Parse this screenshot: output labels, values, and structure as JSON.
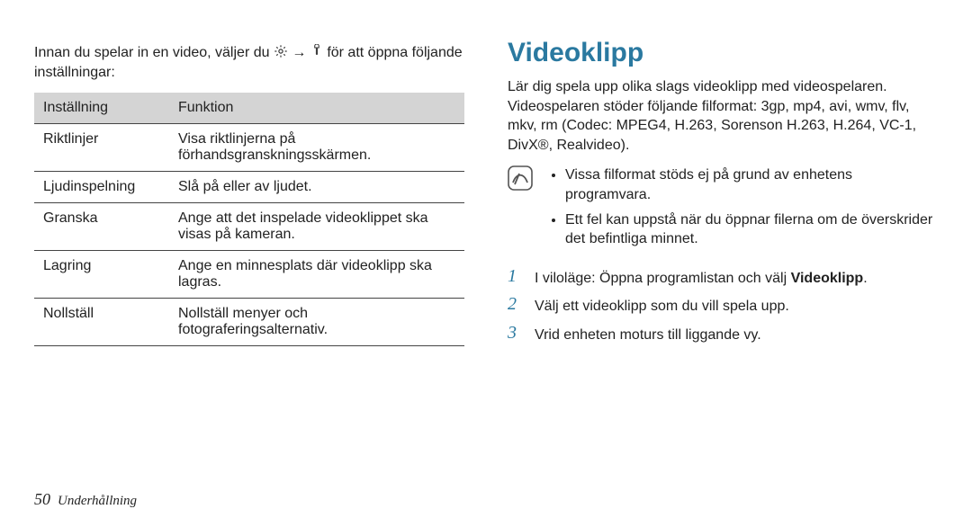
{
  "left": {
    "intro_prefix": "Innan du spelar in en video, väljer du ",
    "intro_arrow": "→",
    "intro_suffix": " för att öppna följande inställningar:",
    "table": {
      "headers": {
        "setting": "Inställning",
        "function": "Funktion"
      },
      "rows": [
        {
          "setting": "Riktlinjer",
          "function": "Visa riktlinjerna på förhandsgranskningsskärmen."
        },
        {
          "setting": "Ljudinspelning",
          "function": "Slå på eller av ljudet."
        },
        {
          "setting": "Granska",
          "function": "Ange att det inspelade videoklippet ska visas på kameran."
        },
        {
          "setting": "Lagring",
          "function": "Ange en minnesplats där videoklipp ska lagras."
        },
        {
          "setting": "Nollställ",
          "function": "Nollställ menyer och fotograferingsalternativ."
        }
      ]
    }
  },
  "right": {
    "heading": "Videoklipp",
    "intro": "Lär dig spela upp olika slags videoklipp med videospelaren. Videospelaren stöder följande filformat: 3gp, mp4, avi, wmv, flv, mkv, rm (Codec: MPEG4, H.263, Sorenson H.263, H.264, VC-1, DivX®, Realvideo).",
    "notes": [
      "Vissa filformat stöds ej på grund av enhetens programvara.",
      "Ett fel kan uppstå när du öppnar filerna om de överskrider det befintliga minnet."
    ],
    "steps": [
      {
        "n": "1",
        "prefix": "I viloläge: Öppna programlistan och välj ",
        "bold": "Videoklipp",
        "suffix": "."
      },
      {
        "n": "2",
        "prefix": "Välj ett videoklipp som du vill spela upp.",
        "bold": "",
        "suffix": ""
      },
      {
        "n": "3",
        "prefix": "Vrid enheten moturs till liggande vy.",
        "bold": "",
        "suffix": ""
      }
    ]
  },
  "footer": {
    "page": "50",
    "section": "Underhållning"
  },
  "icons": {
    "gear": "gear-icon",
    "tool": "tool-icon",
    "note": "note-icon"
  }
}
